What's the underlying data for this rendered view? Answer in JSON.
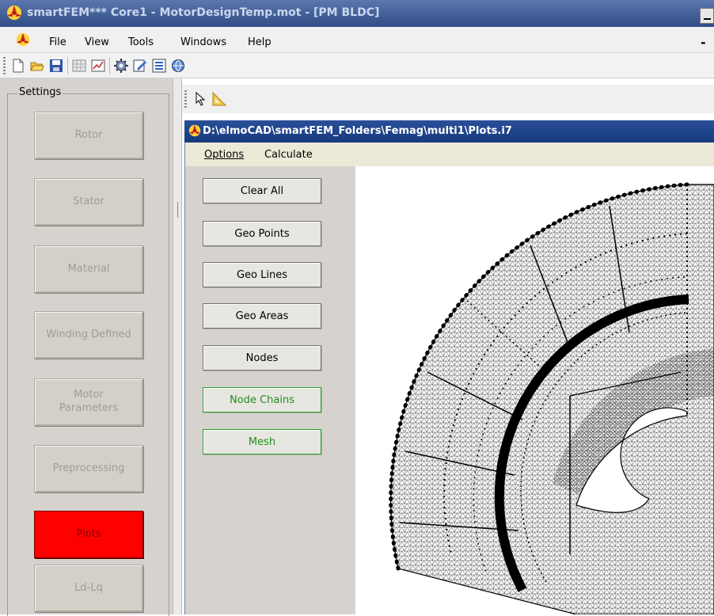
{
  "window": {
    "title": "smartFEM*** Core1 - MotorDesignTemp.mot - [PM BLDC]"
  },
  "menu": {
    "items": [
      "File",
      "View",
      "Tools",
      "Windows",
      "Help"
    ],
    "right_dash": "-"
  },
  "toolbar": {
    "icons": [
      "new-icon",
      "open-folder-icon",
      "save-icon",
      "grid-icon",
      "chart-icon",
      "gear-icon",
      "edit-icon",
      "list-icon",
      "globe-icon"
    ]
  },
  "settings": {
    "group_label": "Settings",
    "buttons": [
      {
        "label": "Rotor",
        "active": false
      },
      {
        "label": "Stator",
        "active": false
      },
      {
        "label": "Material",
        "active": false
      },
      {
        "label": "Winding Defined",
        "active": false
      },
      {
        "label": "Motor\nParameters",
        "active": false
      },
      {
        "label": "Preprocessing",
        "active": false
      },
      {
        "label": "Plots",
        "active": true
      },
      {
        "label": "Ld-Lq",
        "active": false
      }
    ],
    "active_color": "#ff0000"
  },
  "plot_window": {
    "title": "D:\\elmoCAD\\smartFEM_Folders\\Femag\\multi1\\Plots.i7",
    "menu": [
      "Options",
      "Calculate"
    ],
    "buttons": [
      {
        "label": "Clear All",
        "style": "normal"
      },
      {
        "label": "Geo Points",
        "style": "normal"
      },
      {
        "label": "Geo Lines",
        "style": "normal"
      },
      {
        "label": "Geo Areas",
        "style": "normal"
      },
      {
        "label": "Nodes",
        "style": "normal"
      },
      {
        "label": "Node Chains",
        "style": "green"
      },
      {
        "label": "Mesh",
        "style": "green"
      }
    ]
  },
  "colors": {
    "title_bar": "#3a5a96",
    "plot_title_bar": "#1f4590",
    "panel_bg": "#d6d3ce",
    "green_border": "#2a9b2a"
  }
}
